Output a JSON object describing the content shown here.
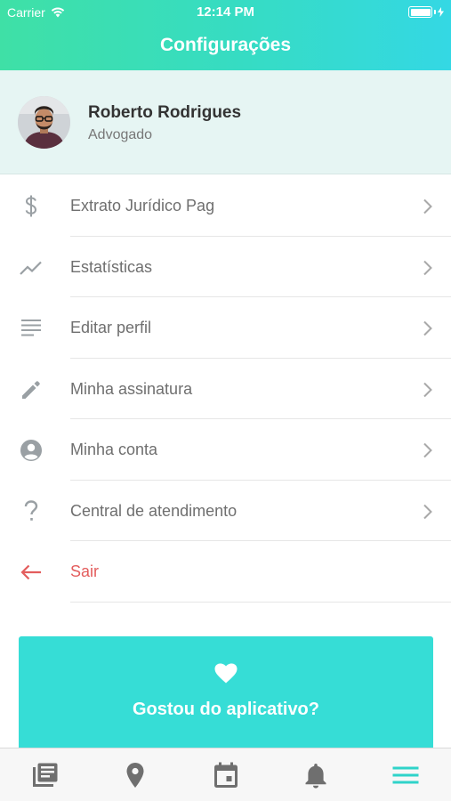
{
  "status_bar": {
    "carrier": "Carrier",
    "time": "12:14 PM"
  },
  "header": {
    "title": "Configurações"
  },
  "profile": {
    "name": "Roberto Rodrigues",
    "role": "Advogado"
  },
  "menu": {
    "items": [
      {
        "label": "Extrato Jurídico Pag",
        "icon": "dollar-icon"
      },
      {
        "label": "Estatísticas",
        "icon": "trending-icon"
      },
      {
        "label": "Editar perfil",
        "icon": "text-lines-icon"
      },
      {
        "label": "Minha assinatura",
        "icon": "pencil-icon"
      },
      {
        "label": "Minha conta",
        "icon": "account-circle-icon"
      },
      {
        "label": "Central de atendimento",
        "icon": "question-icon"
      },
      {
        "label": "Sair",
        "icon": "arrow-left-icon"
      }
    ]
  },
  "promo": {
    "text": "Gostou do aplicativo?",
    "icon": "heart-icon"
  },
  "tabbar": {
    "tabs": [
      {
        "icon": "news-icon",
        "active": false
      },
      {
        "icon": "location-pin-icon",
        "active": false
      },
      {
        "icon": "calendar-icon",
        "active": false
      },
      {
        "icon": "bell-icon",
        "active": false
      },
      {
        "icon": "menu-icon",
        "active": true
      }
    ]
  },
  "colors": {
    "header_gradient_start": "#3fe0a6",
    "header_gradient_end": "#34d8e4",
    "accent": "#36ddd6",
    "danger": "#e35d5d",
    "profile_bg": "#e6f5f3"
  }
}
